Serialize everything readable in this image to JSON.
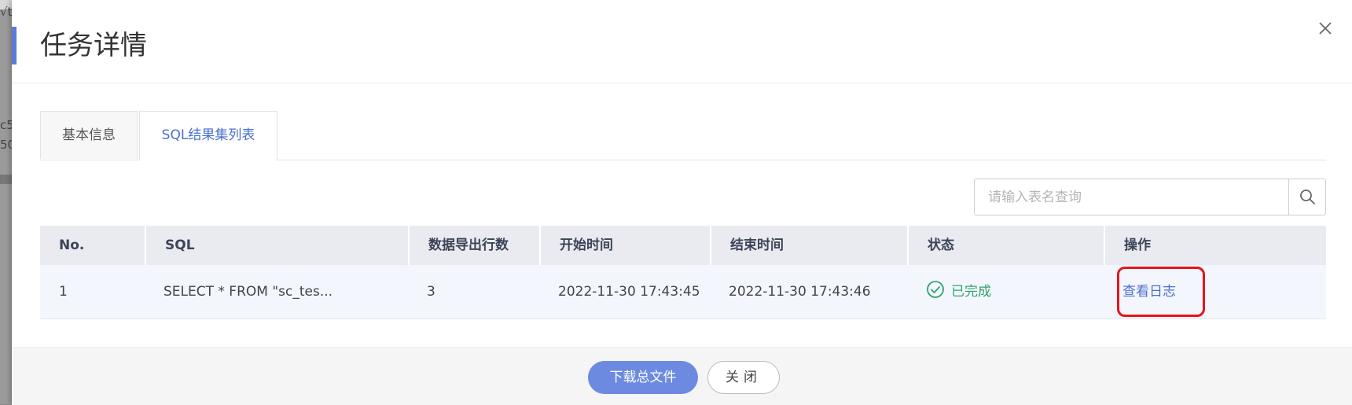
{
  "background": {
    "fragments": [
      "√t",
      "c5",
      "50"
    ]
  },
  "modal": {
    "title": "任务详情",
    "close_icon": "close-icon",
    "accent_color": "#5b7bd5"
  },
  "tabs": [
    {
      "label": "基本信息",
      "active": false
    },
    {
      "label": "SQL结果集列表",
      "active": true
    }
  ],
  "search": {
    "placeholder": "请输入表名查询",
    "value": "",
    "icon": "search-icon"
  },
  "table": {
    "columns": [
      "No.",
      "SQL",
      "数据导出行数",
      "开始时间",
      "结束时间",
      "状态",
      "操作"
    ],
    "rows": [
      {
        "no": "1",
        "sql": "SELECT * FROM \"sc_tes...",
        "rows_exported": "3",
        "start_time": "2022-11-30 17:43:45",
        "end_time": "2022-11-30 17:43:46",
        "status": "已完成",
        "status_icon": "check-circle-icon",
        "status_color": "#2fa56b",
        "action": "查看日志"
      }
    ]
  },
  "footer": {
    "download_label": "下载总文件",
    "close_label": "关闭"
  },
  "highlight_color": "#e8141a"
}
